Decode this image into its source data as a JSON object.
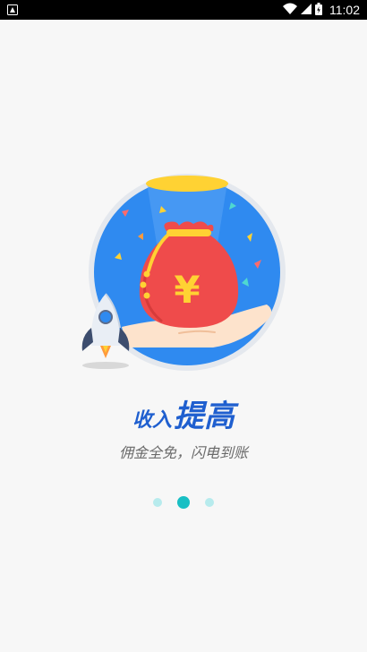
{
  "status_bar": {
    "time": "11:02",
    "icons": [
      "notification-icon",
      "wifi-icon",
      "signal-icon",
      "battery-icon"
    ]
  },
  "illustration": {
    "symbol": "¥",
    "icons": [
      "money-bag",
      "hand",
      "rocket",
      "confetti"
    ]
  },
  "headline": {
    "prefix": "收入",
    "emphasis": "提高"
  },
  "subtitle": "佣金全免，闪电到账",
  "pager": {
    "pages": 3,
    "active_index": 1
  },
  "colors": {
    "accent_blue": "#1f5fcf",
    "dot_active": "#19bfc4",
    "dot_inactive": "#b7ebed",
    "bag_red": "#ef4b4b",
    "circle_blue": "#2f8af0"
  }
}
